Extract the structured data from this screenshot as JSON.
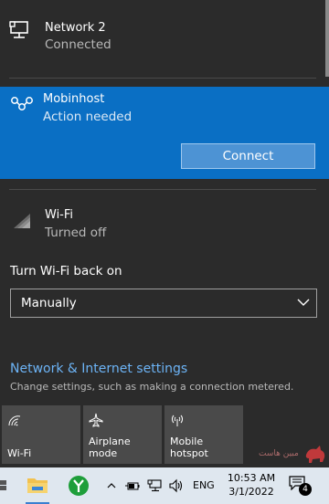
{
  "networks": {
    "network2": {
      "name": "Network 2",
      "status": "Connected",
      "icon": "ethernet-icon"
    },
    "mobinhost": {
      "name": "Mobinhost",
      "status": "Action needed",
      "icon": "wifi-hotspot-icon",
      "connect_label": "Connect"
    },
    "wifi": {
      "name": "Wi-Fi",
      "status": "Turned off",
      "icon": "wifi-off-icon"
    }
  },
  "wifi_restore": {
    "label": "Turn Wi-Fi back on",
    "selected": "Manually"
  },
  "settings": {
    "link": "Network & Internet settings",
    "description": "Change settings, such as making a connection metered."
  },
  "quick_actions": [
    {
      "label": "Wi-Fi",
      "icon": "wifi-icon"
    },
    {
      "label": "Airplane mode",
      "icon": "airplane-icon"
    },
    {
      "label": "Mobile\nhotspot",
      "icon": "hotspot-icon"
    }
  ],
  "watermark": {
    "text": "مبین هاست"
  },
  "taskbar": {
    "language": "ENG",
    "time": "10:53 AM",
    "date": "3/1/2022",
    "notification_count": "4"
  },
  "colors": {
    "flyout_bg": "#2b2b2b",
    "selected_bg": "#0a6fc4",
    "link": "#6cb3f5",
    "tile_bg": "#4a4a4a",
    "taskbar_bg": "#dfe7ef"
  }
}
